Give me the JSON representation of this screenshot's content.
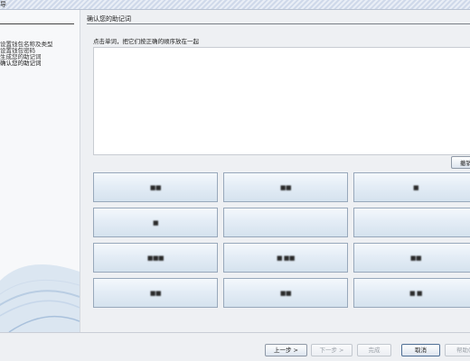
{
  "window": {
    "title": "导"
  },
  "sidebar": {
    "steps": [
      {
        "label": "设置钱包名称及类型"
      },
      {
        "label": "设置钱包密码"
      },
      {
        "label": "生成您的助记词"
      },
      {
        "label": "确认您的助记词"
      }
    ]
  },
  "main": {
    "section_title": "确认您的助记词",
    "instruction": "点击单词，把它们按正确的顺序放在一起",
    "undo_label": "撤销",
    "word_tiles": [
      {
        "word": "■■"
      },
      {
        "word": "■■"
      },
      {
        "word": "■"
      },
      {
        "word": "■"
      },
      {
        "word": ""
      },
      {
        "word": ""
      },
      {
        "word": "■■■"
      },
      {
        "word": "■ ■■"
      },
      {
        "word": "■■"
      },
      {
        "word": "■■"
      },
      {
        "word": "■■"
      },
      {
        "word": "■ ■"
      }
    ]
  },
  "footer": {
    "prev_label": "上一步 >",
    "next_label": "下一步 >",
    "finish_label": "完成",
    "cancel_label": "取消",
    "help_label": "帮助(H)"
  }
}
